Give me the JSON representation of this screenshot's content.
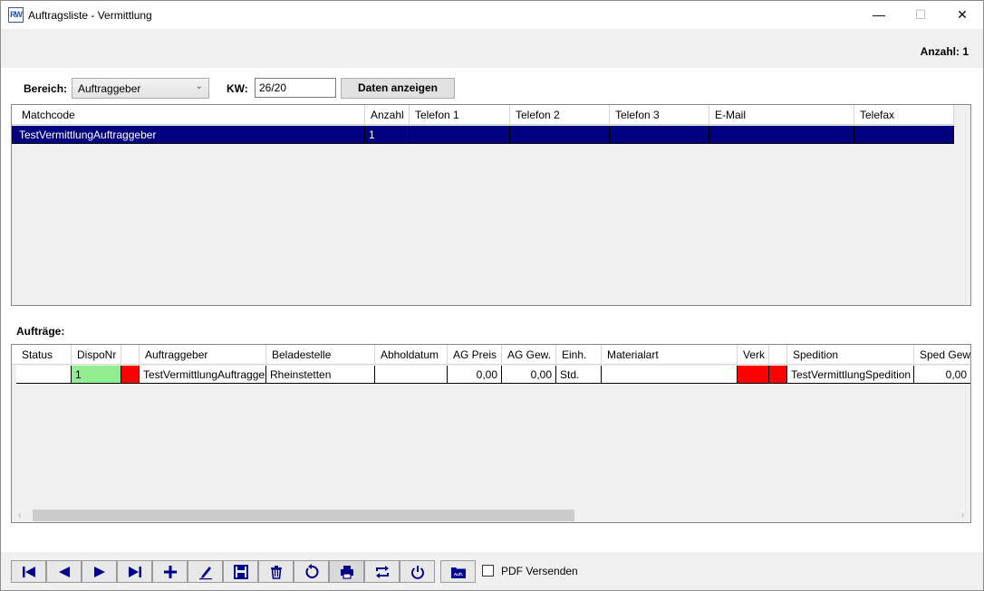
{
  "window": {
    "title": "Auftragsliste - Vermittlung",
    "app_icon_text_1": "R",
    "app_icon_text_2": "W"
  },
  "header": {
    "count": "Anzahl: 1"
  },
  "filters": {
    "bereich_label": "Bereich:",
    "bereich_value": "Auftraggeber",
    "kw_label": "KW:",
    "kw_value": "26/20",
    "show_button": "Daten anzeigen"
  },
  "grid1": {
    "columns": [
      "Matchcode",
      "Anzahl",
      "Telefon 1",
      "Telefon 2",
      "Telefon 3",
      "E-Mail",
      "Telefax"
    ],
    "rows": [
      {
        "matchcode": "TestVermittlungAuftraggeber",
        "anzahl": "1",
        "tel1": "",
        "tel2": "",
        "tel3": "",
        "email": "",
        "fax": ""
      }
    ]
  },
  "orders_label": "Aufträge:",
  "grid2": {
    "columns": [
      "Status",
      "DispoNr",
      "",
      "Auftraggeber",
      "Beladestelle",
      "Abholdatum",
      "AG Preis",
      "AG Gew.",
      "Einh.",
      "Materialart",
      "Verk",
      "",
      "Spedition",
      "Sped Gew."
    ],
    "rows": [
      {
        "status": "",
        "disponr": "1",
        "auftraggeber": "TestVermittlungAuftraggeber",
        "beladestelle": "Rheinstetten",
        "abholdatum": "",
        "ag_preis": "0,00",
        "ag_gew": "0,00",
        "einh": "Std.",
        "materialart": "",
        "spedition": "TestVermittlungSpedition",
        "sped_gew": "0,00"
      }
    ]
  },
  "toolbar": {
    "pdf_label": "PDF Versenden",
    "folder_label": "Auft."
  },
  "colors": {
    "selection": "#000080",
    "status_green": "#90ee90",
    "status_red": "#ff0000",
    "icon_blue": "#00008b"
  }
}
